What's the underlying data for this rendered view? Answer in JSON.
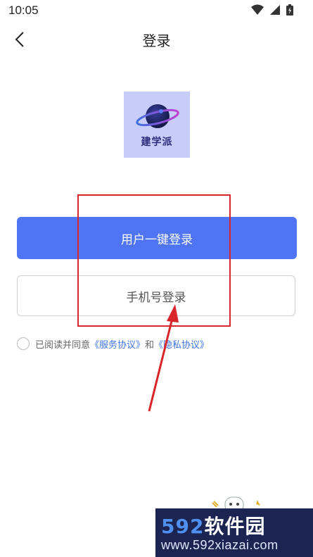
{
  "status_bar": {
    "time": "10:05",
    "icons": [
      "wifi-icon",
      "signal-icon",
      "battery-icon"
    ]
  },
  "header": {
    "title": "登录",
    "back_icon": "chevron-left-icon"
  },
  "logo": {
    "text": "建学派",
    "icon": "planet-icon",
    "bg_color": "#c7cdf8"
  },
  "buttons": {
    "one_click_login": "用户一键登录",
    "phone_login": "手机号登录"
  },
  "agreement": {
    "prefix": "已阅读并同意",
    "service_agreement": "《服务协议》",
    "conjunction": "和",
    "privacy_agreement": "《隐私协议》"
  },
  "watermark": {
    "brand_number": "592",
    "brand_text": "软件园",
    "url": "www.592xiazai.com"
  },
  "colors": {
    "primary": "#4f75f5",
    "link": "#3d74e6",
    "annotation": "#d8262b"
  }
}
